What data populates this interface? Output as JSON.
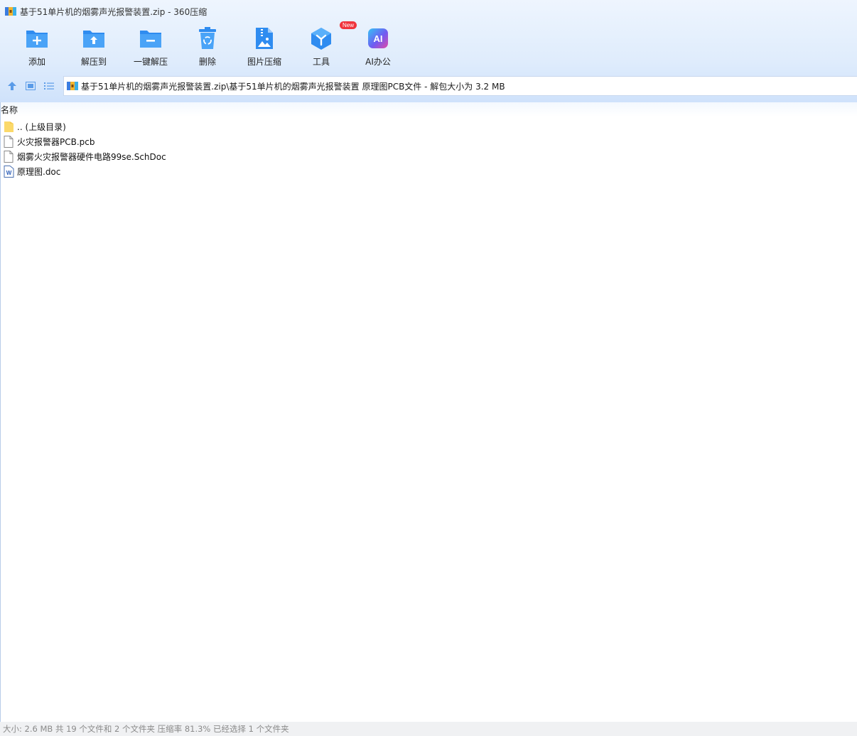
{
  "window": {
    "title": "基于51单片机的烟雾声光报警装置.zip - 360压缩"
  },
  "toolbar": {
    "items": [
      {
        "label": "添加",
        "icon": "add-folder-icon"
      },
      {
        "label": "解压到",
        "icon": "extract-to-icon"
      },
      {
        "label": "一键解压",
        "icon": "one-click-extract-icon"
      },
      {
        "label": "删除",
        "icon": "recycle-bin-icon"
      },
      {
        "label": "图片压缩",
        "icon": "image-compress-icon"
      },
      {
        "label": "工具",
        "icon": "tools-cube-icon",
        "badge": "New"
      },
      {
        "label": "AI办公",
        "icon": "ai-office-icon"
      }
    ]
  },
  "address": {
    "path": "基于51单片机的烟雾声光报警装置.zip\\基于51单片机的烟雾声光报警装置 原理图PCB文件 - 解包大小为 3.2 MB"
  },
  "list": {
    "column_name": "名称",
    "items": [
      {
        "name": ".. (上级目录)",
        "icon": "folder-icon"
      },
      {
        "name": "火灾报警器PCB.pcb",
        "icon": "file-icon"
      },
      {
        "name": "烟雾火灾报警器硬件电路99se.SchDoc",
        "icon": "file-icon"
      },
      {
        "name": "原理图.doc",
        "icon": "word-doc-icon"
      }
    ]
  },
  "status": {
    "text": "大小: 2.6 MB 共 19 个文件和 2 个文件夹 压缩率 81.3% 已经选择 1 个文件夹"
  },
  "colors": {
    "accent_blue": "#2f8cf0",
    "badge_red": "#f0343c",
    "header_bg": "#dfecfc"
  }
}
